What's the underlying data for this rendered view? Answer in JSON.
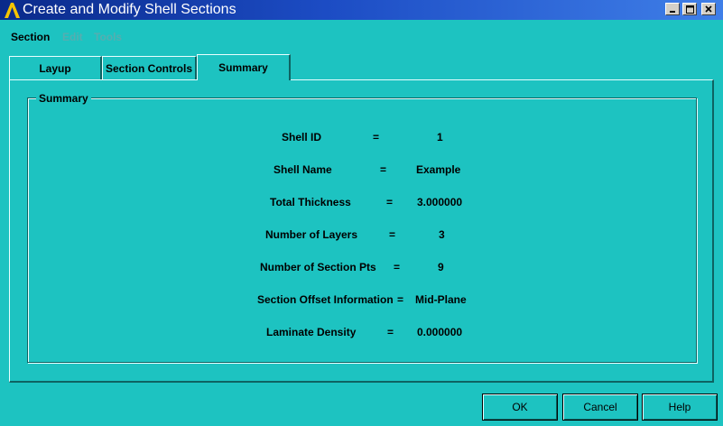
{
  "window": {
    "title": "Create and Modify Shell Sections",
    "controls": [
      "minimize-icon",
      "maximize-icon",
      "close-icon"
    ]
  },
  "menu": [
    {
      "label": "Section",
      "enabled": true
    },
    {
      "label": "Edit",
      "enabled": false
    },
    {
      "label": "Tools",
      "enabled": false
    }
  ],
  "tabs": [
    {
      "label": "Layup",
      "active": false
    },
    {
      "label": "Section Controls",
      "active": false
    },
    {
      "label": "Summary",
      "active": true
    }
  ],
  "summary": {
    "group_title": "Summary",
    "rows": [
      {
        "label": "Shell ID",
        "eq": "=",
        "value": "1"
      },
      {
        "label": "Shell Name",
        "eq": "=",
        "value": "Example"
      },
      {
        "label": "Total Thickness",
        "eq": "=",
        "value": "3.000000"
      },
      {
        "label": "Number of Layers",
        "eq": "=",
        "value": "3"
      },
      {
        "label": "Number of Section Pts",
        "eq": "=",
        "value": "9"
      },
      {
        "label": "Section Offset Information",
        "eq": "=",
        "value": "Mid-Plane"
      },
      {
        "label": "Laminate Density",
        "eq": "=",
        "value": "0.000000"
      }
    ]
  },
  "buttons": {
    "ok": "OK",
    "cancel": "Cancel",
    "help": "Help"
  },
  "colors": {
    "background": "#1dc3c1",
    "titlebar": "#0a2a8a",
    "disabled_text": "#55aeb0"
  }
}
